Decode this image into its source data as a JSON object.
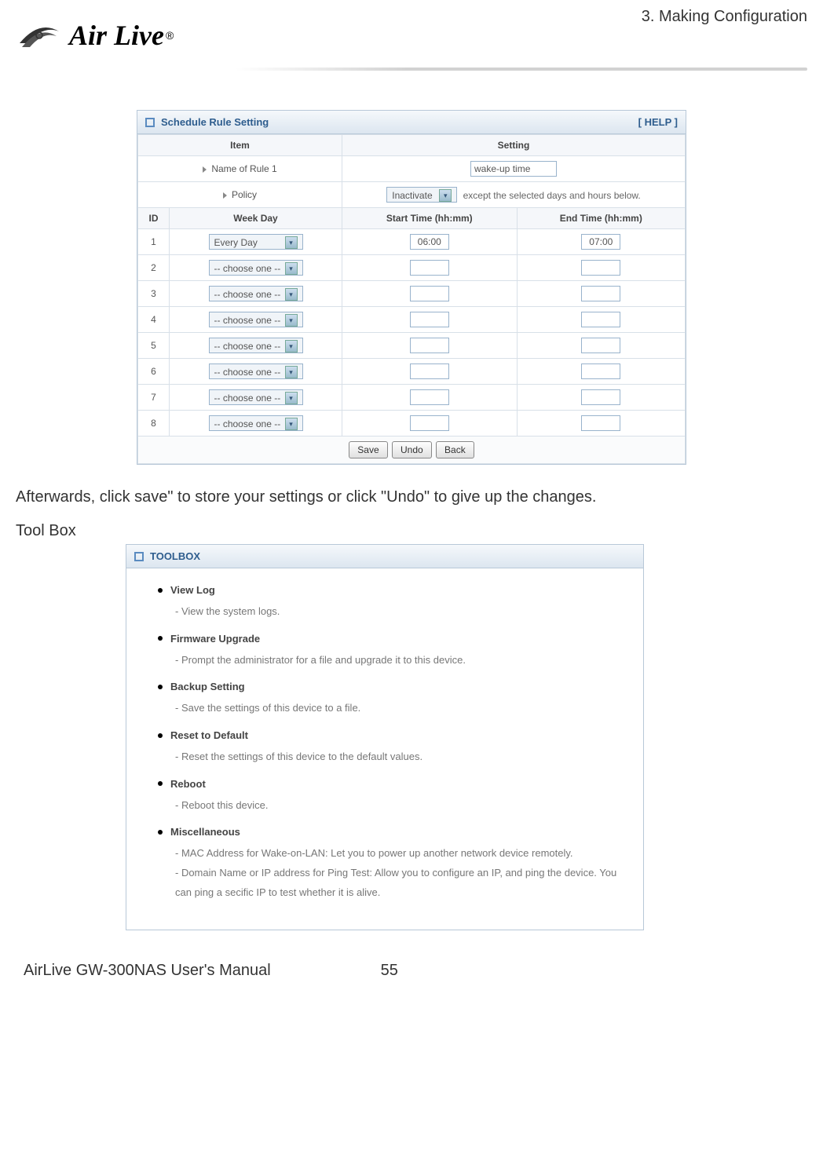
{
  "chapter": "3.  Making  Configuration",
  "logo": {
    "text": "Air Live",
    "reg": "®"
  },
  "schedule_panel": {
    "title": "Schedule Rule Setting",
    "help": "[ HELP ]",
    "head_item": "Item",
    "head_setting": "Setting",
    "name_label": "Name of Rule 1",
    "name_value": "wake-up time",
    "policy_label": "Policy",
    "policy_value": "Inactivate",
    "policy_note": "except the selected days and hours below.",
    "col_id": "ID",
    "col_weekday": "Week Day",
    "col_start": "Start Time (hh:mm)",
    "col_end": "End Time (hh:mm)",
    "rows": [
      {
        "id": "1",
        "day": "Every Day",
        "start": "06:00",
        "end": "07:00"
      },
      {
        "id": "2",
        "day": "-- choose one --",
        "start": "",
        "end": ""
      },
      {
        "id": "3",
        "day": "-- choose one --",
        "start": "",
        "end": ""
      },
      {
        "id": "4",
        "day": "-- choose one --",
        "start": "",
        "end": ""
      },
      {
        "id": "5",
        "day": "-- choose one --",
        "start": "",
        "end": ""
      },
      {
        "id": "6",
        "day": "-- choose one --",
        "start": "",
        "end": ""
      },
      {
        "id": "7",
        "day": "-- choose one --",
        "start": "",
        "end": ""
      },
      {
        "id": "8",
        "day": "-- choose one --",
        "start": "",
        "end": ""
      }
    ],
    "btn_save": "Save",
    "btn_undo": "Undo",
    "btn_back": "Back"
  },
  "para1": "Afterwards, click save\" to store your settings or click \"Undo\" to give up the changes.",
  "toolbox_heading": "Tool Box",
  "toolbox_panel": {
    "title": "TOOLBOX",
    "items": [
      {
        "title": "View Log",
        "desc": "- View the system logs."
      },
      {
        "title": "Firmware Upgrade",
        "desc": "- Prompt the administrator for a file and upgrade it to this device."
      },
      {
        "title": "Backup Setting",
        "desc": "- Save the settings of this device to a file."
      },
      {
        "title": "Reset to Default",
        "desc": "- Reset the settings of this device to the default values."
      },
      {
        "title": "Reboot",
        "desc": "- Reboot this device."
      },
      {
        "title": "Miscellaneous",
        "desc": "- MAC Address for Wake-on-LAN: Let you to power up another network device remotely.\n- Domain Name or IP address for Ping Test: Allow you to configure an IP, and ping the device. You can ping a secific IP to test whether it is alive."
      }
    ]
  },
  "footer": {
    "manual": "AirLive GW-300NAS User's Manual",
    "page": "55"
  }
}
